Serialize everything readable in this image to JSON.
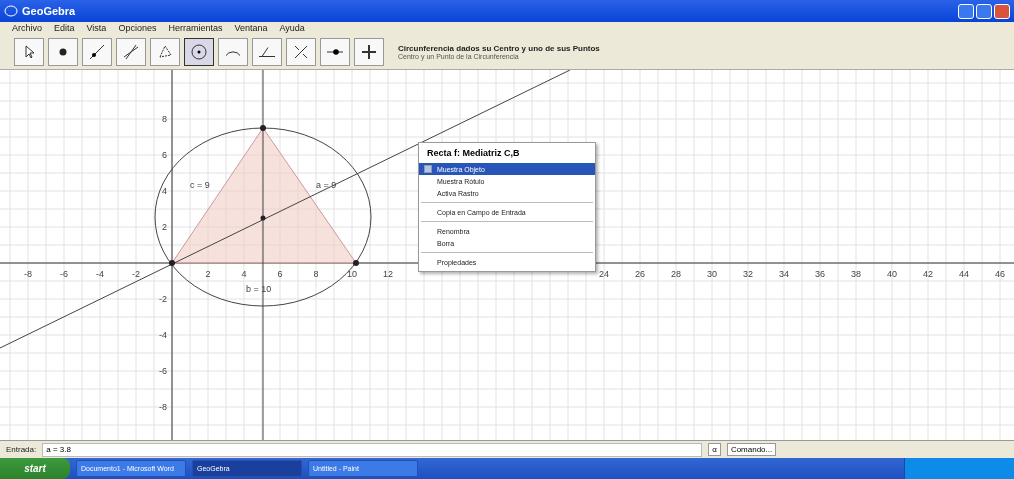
{
  "window": {
    "title": "GeoGebra"
  },
  "menu": [
    "Archivo",
    "Edita",
    "Vista",
    "Opciones",
    "Herramientas",
    "Ventana",
    "Ayuda"
  ],
  "toolbar": {
    "tools": [
      {
        "kind": "pointer",
        "selected": false
      },
      {
        "kind": "point",
        "selected": false
      },
      {
        "kind": "line",
        "selected": false
      },
      {
        "kind": "perpendicular",
        "selected": false
      },
      {
        "kind": "polygon",
        "selected": false
      },
      {
        "kind": "circle",
        "selected": true
      },
      {
        "kind": "arc",
        "selected": false
      },
      {
        "kind": "angle",
        "selected": false
      },
      {
        "kind": "reflect",
        "selected": false
      },
      {
        "kind": "text",
        "selected": false
      },
      {
        "kind": "move",
        "selected": false
      }
    ],
    "tool_name": "Circunferencia dados su Centro y uno de sus Puntos",
    "tool_help": "Centro y un Punto de la Circunferencia"
  },
  "graphics": {
    "x_ticks": [
      "-8",
      "-6",
      "-4",
      "-2",
      "2",
      "4",
      "6",
      "8",
      "10",
      "12",
      "24",
      "26",
      "28",
      "30",
      "32",
      "34",
      "36",
      "38",
      "40",
      "42",
      "44",
      "46"
    ],
    "y_ticks": [
      "8",
      "6",
      "4",
      "2",
      "-2",
      "-4",
      "-6",
      "-8"
    ],
    "labels": [
      "c = 9",
      "a = 9",
      "b = 10"
    ]
  },
  "context_menu": {
    "title": "Recta f: Mediatriz C,B",
    "items": [
      {
        "kind": "check",
        "label": "Muestra Objeto",
        "selected": true
      },
      {
        "kind": "item",
        "label": "Muestra Rótulo",
        "selected": false
      },
      {
        "kind": "item",
        "label": "Activa Rastro",
        "selected": false
      },
      {
        "kind": "separator"
      },
      {
        "kind": "item",
        "label": "Copia en Campo de Entrada",
        "selected": false
      },
      {
        "kind": "separator"
      },
      {
        "kind": "item",
        "label": "Renombra",
        "selected": false
      },
      {
        "kind": "item",
        "label": "Borra",
        "selected": false
      },
      {
        "kind": "separator"
      },
      {
        "kind": "item",
        "label": "Propiedades",
        "selected": false
      }
    ]
  },
  "input_bar": {
    "label": "Entrada:",
    "value": "a = 3.8",
    "symbol": "α",
    "command": "Comando..."
  },
  "taskbar": {
    "start": "start",
    "tasks": [
      {
        "label": "Documento1 - Microsoft Word",
        "selected": false
      },
      {
        "label": "GeoGebra",
        "selected": true
      },
      {
        "label": "Untitled - Paint",
        "selected": false
      }
    ]
  }
}
